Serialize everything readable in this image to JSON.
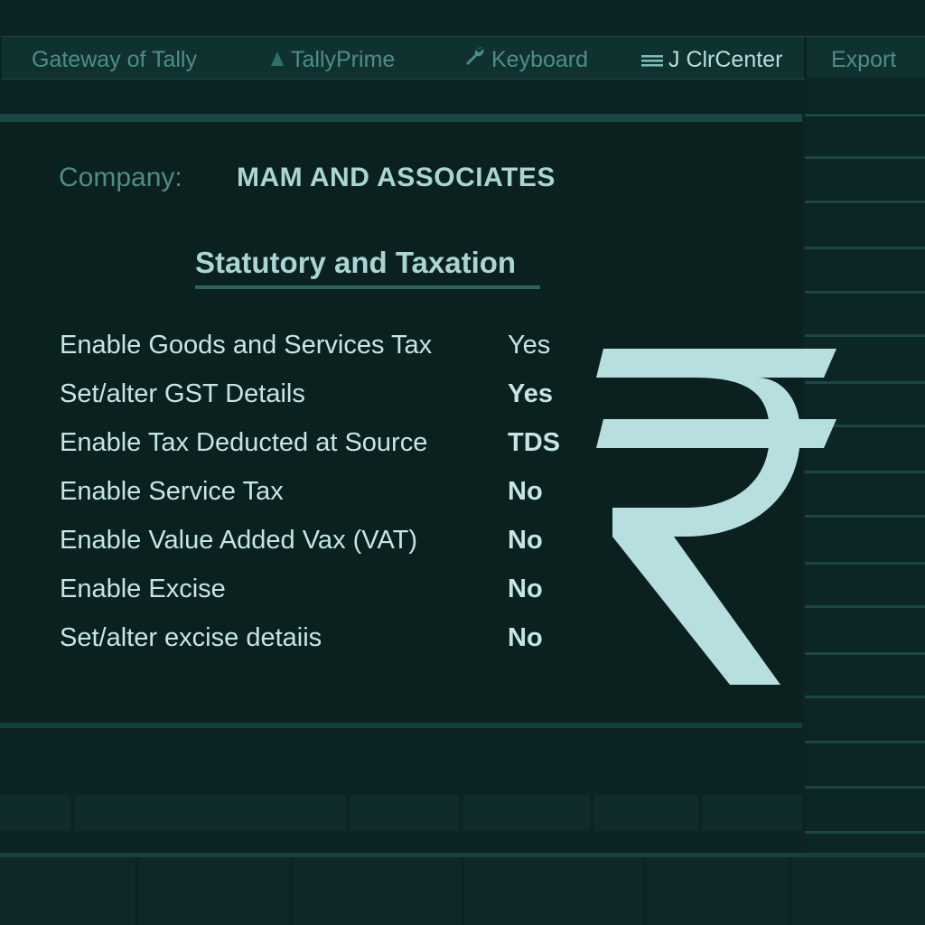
{
  "menu": {
    "gateway": {
      "label": "Gateway of Tally"
    },
    "tallyprime": {
      "label": "TallyPrime",
      "icon": "triangle-icon"
    },
    "keyboard": {
      "label": "Keyboard",
      "icon": "wrench-icon"
    },
    "center": {
      "label": "J ClrCenter",
      "icon": "lines-icon"
    },
    "export": {
      "label": "Export"
    }
  },
  "company": {
    "label": "Company:",
    "name": "MAM AND ASSOCIATES"
  },
  "section": {
    "title": "Statutory and Taxation"
  },
  "options": [
    {
      "label": "Enable Goods and Services Tax",
      "value": "Yes"
    },
    {
      "label": "Set/alter GST Details",
      "value": "Yes"
    },
    {
      "label": "Enable Tax Deducted at Source",
      "value": "TDS"
    },
    {
      "label": "Enable Service Tax",
      "value": "No"
    },
    {
      "label": "Enable Value Added Vax (VAT)",
      "value": "No"
    },
    {
      "label": "Enable Excise",
      "value": "No"
    },
    {
      "label": "Set/alter excise detaiis",
      "value": "No"
    }
  ],
  "graphic": {
    "icon": "rupee-icon",
    "color": "#b8dfe0"
  },
  "colors": {
    "background": "#0c2423",
    "accent": "#a9d6d4",
    "muted": "#4f8c88"
  }
}
